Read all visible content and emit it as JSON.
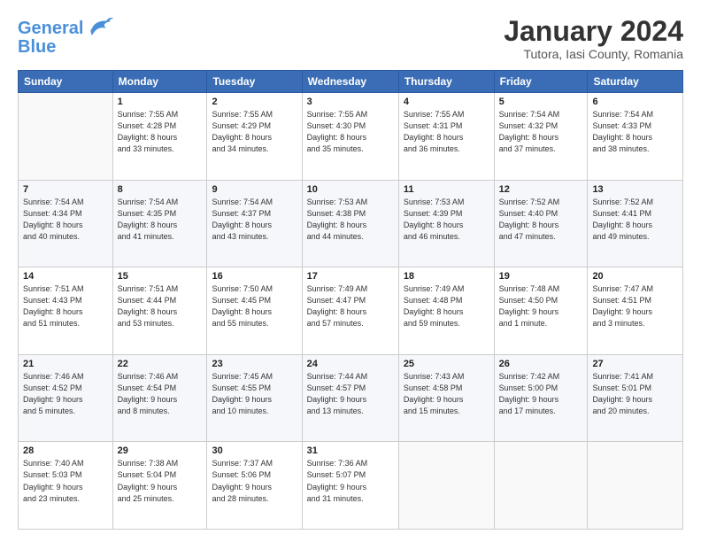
{
  "header": {
    "logo_line1": "General",
    "logo_line2": "Blue",
    "month_title": "January 2024",
    "subtitle": "Tutora, Iasi County, Romania"
  },
  "weekdays": [
    "Sunday",
    "Monday",
    "Tuesday",
    "Wednesday",
    "Thursday",
    "Friday",
    "Saturday"
  ],
  "weeks": [
    [
      {
        "day": "",
        "info": ""
      },
      {
        "day": "1",
        "info": "Sunrise: 7:55 AM\nSunset: 4:28 PM\nDaylight: 8 hours\nand 33 minutes."
      },
      {
        "day": "2",
        "info": "Sunrise: 7:55 AM\nSunset: 4:29 PM\nDaylight: 8 hours\nand 34 minutes."
      },
      {
        "day": "3",
        "info": "Sunrise: 7:55 AM\nSunset: 4:30 PM\nDaylight: 8 hours\nand 35 minutes."
      },
      {
        "day": "4",
        "info": "Sunrise: 7:55 AM\nSunset: 4:31 PM\nDaylight: 8 hours\nand 36 minutes."
      },
      {
        "day": "5",
        "info": "Sunrise: 7:54 AM\nSunset: 4:32 PM\nDaylight: 8 hours\nand 37 minutes."
      },
      {
        "day": "6",
        "info": "Sunrise: 7:54 AM\nSunset: 4:33 PM\nDaylight: 8 hours\nand 38 minutes."
      }
    ],
    [
      {
        "day": "7",
        "info": "Sunrise: 7:54 AM\nSunset: 4:34 PM\nDaylight: 8 hours\nand 40 minutes."
      },
      {
        "day": "8",
        "info": "Sunrise: 7:54 AM\nSunset: 4:35 PM\nDaylight: 8 hours\nand 41 minutes."
      },
      {
        "day": "9",
        "info": "Sunrise: 7:54 AM\nSunset: 4:37 PM\nDaylight: 8 hours\nand 43 minutes."
      },
      {
        "day": "10",
        "info": "Sunrise: 7:53 AM\nSunset: 4:38 PM\nDaylight: 8 hours\nand 44 minutes."
      },
      {
        "day": "11",
        "info": "Sunrise: 7:53 AM\nSunset: 4:39 PM\nDaylight: 8 hours\nand 46 minutes."
      },
      {
        "day": "12",
        "info": "Sunrise: 7:52 AM\nSunset: 4:40 PM\nDaylight: 8 hours\nand 47 minutes."
      },
      {
        "day": "13",
        "info": "Sunrise: 7:52 AM\nSunset: 4:41 PM\nDaylight: 8 hours\nand 49 minutes."
      }
    ],
    [
      {
        "day": "14",
        "info": "Sunrise: 7:51 AM\nSunset: 4:43 PM\nDaylight: 8 hours\nand 51 minutes."
      },
      {
        "day": "15",
        "info": "Sunrise: 7:51 AM\nSunset: 4:44 PM\nDaylight: 8 hours\nand 53 minutes."
      },
      {
        "day": "16",
        "info": "Sunrise: 7:50 AM\nSunset: 4:45 PM\nDaylight: 8 hours\nand 55 minutes."
      },
      {
        "day": "17",
        "info": "Sunrise: 7:49 AM\nSunset: 4:47 PM\nDaylight: 8 hours\nand 57 minutes."
      },
      {
        "day": "18",
        "info": "Sunrise: 7:49 AM\nSunset: 4:48 PM\nDaylight: 8 hours\nand 59 minutes."
      },
      {
        "day": "19",
        "info": "Sunrise: 7:48 AM\nSunset: 4:50 PM\nDaylight: 9 hours\nand 1 minute."
      },
      {
        "day": "20",
        "info": "Sunrise: 7:47 AM\nSunset: 4:51 PM\nDaylight: 9 hours\nand 3 minutes."
      }
    ],
    [
      {
        "day": "21",
        "info": "Sunrise: 7:46 AM\nSunset: 4:52 PM\nDaylight: 9 hours\nand 5 minutes."
      },
      {
        "day": "22",
        "info": "Sunrise: 7:46 AM\nSunset: 4:54 PM\nDaylight: 9 hours\nand 8 minutes."
      },
      {
        "day": "23",
        "info": "Sunrise: 7:45 AM\nSunset: 4:55 PM\nDaylight: 9 hours\nand 10 minutes."
      },
      {
        "day": "24",
        "info": "Sunrise: 7:44 AM\nSunset: 4:57 PM\nDaylight: 9 hours\nand 13 minutes."
      },
      {
        "day": "25",
        "info": "Sunrise: 7:43 AM\nSunset: 4:58 PM\nDaylight: 9 hours\nand 15 minutes."
      },
      {
        "day": "26",
        "info": "Sunrise: 7:42 AM\nSunset: 5:00 PM\nDaylight: 9 hours\nand 17 minutes."
      },
      {
        "day": "27",
        "info": "Sunrise: 7:41 AM\nSunset: 5:01 PM\nDaylight: 9 hours\nand 20 minutes."
      }
    ],
    [
      {
        "day": "28",
        "info": "Sunrise: 7:40 AM\nSunset: 5:03 PM\nDaylight: 9 hours\nand 23 minutes."
      },
      {
        "day": "29",
        "info": "Sunrise: 7:38 AM\nSunset: 5:04 PM\nDaylight: 9 hours\nand 25 minutes."
      },
      {
        "day": "30",
        "info": "Sunrise: 7:37 AM\nSunset: 5:06 PM\nDaylight: 9 hours\nand 28 minutes."
      },
      {
        "day": "31",
        "info": "Sunrise: 7:36 AM\nSunset: 5:07 PM\nDaylight: 9 hours\nand 31 minutes."
      },
      {
        "day": "",
        "info": ""
      },
      {
        "day": "",
        "info": ""
      },
      {
        "day": "",
        "info": ""
      }
    ]
  ]
}
